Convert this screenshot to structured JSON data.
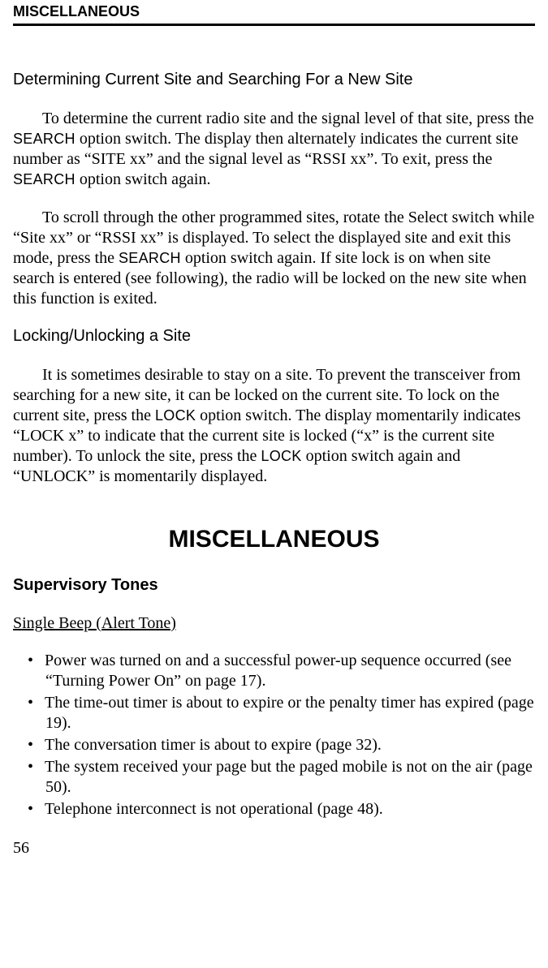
{
  "running_head": "MISCELLANEOUS",
  "h_determine": "Determining Current Site and Searching For a New Site",
  "p1_a": "To determine the current radio site and the signal level of that site, press the ",
  "p1_s1": "SEARCH",
  "p1_b": " option switch. The display then alternately indicates the current site number as “SITE xx” and the signal level as “RSSI xx”. To exit, press the ",
  "p1_s2": "SEARCH",
  "p1_c": " option switch again.",
  "p2_a": "To scroll through the other programmed sites, rotate the Select switch while “Site xx” or “RSSI xx” is displayed. To select the displayed site and exit this mode, press the ",
  "p2_s1": "SEARCH",
  "p2_b": " option switch again. If site lock is on when site search is entered (see following), the radio will be locked on the new site when this function is exited.",
  "h_lock": "Locking/Unlocking a Site",
  "p3_a": "It is sometimes desirable to stay on a site. To prevent the transceiver from searching for a new site, it can be locked on the current site. To lock on the current site, press the ",
  "p3_s1": "LOCK",
  "p3_b": " option switch. The display momentarily indicates “LOCK x” to indicate that the current site is locked (“x” is the current site number). To unlock the site, press the ",
  "p3_s2": "LOCK",
  "p3_c": " option switch again and “UNLOCK” is momentarily displayed.",
  "section_title": "MISCELLANEOUS",
  "h_supervisory": "Supervisory Tones",
  "h_single_beep": "Single Beep (Alert Tone)",
  "bullets": [
    "Power was turned on and a successful power-up sequence occurred (see “Turning Power On” on page 17).",
    "The time-out timer is about to expire or the penalty timer has expired (page 19).",
    "The conversation timer is about to expire (page 32).",
    "The system received your page but the paged mobile is not on the air (page 50).",
    "Telephone interconnect is not operational (page 48)."
  ],
  "page_number": "56"
}
